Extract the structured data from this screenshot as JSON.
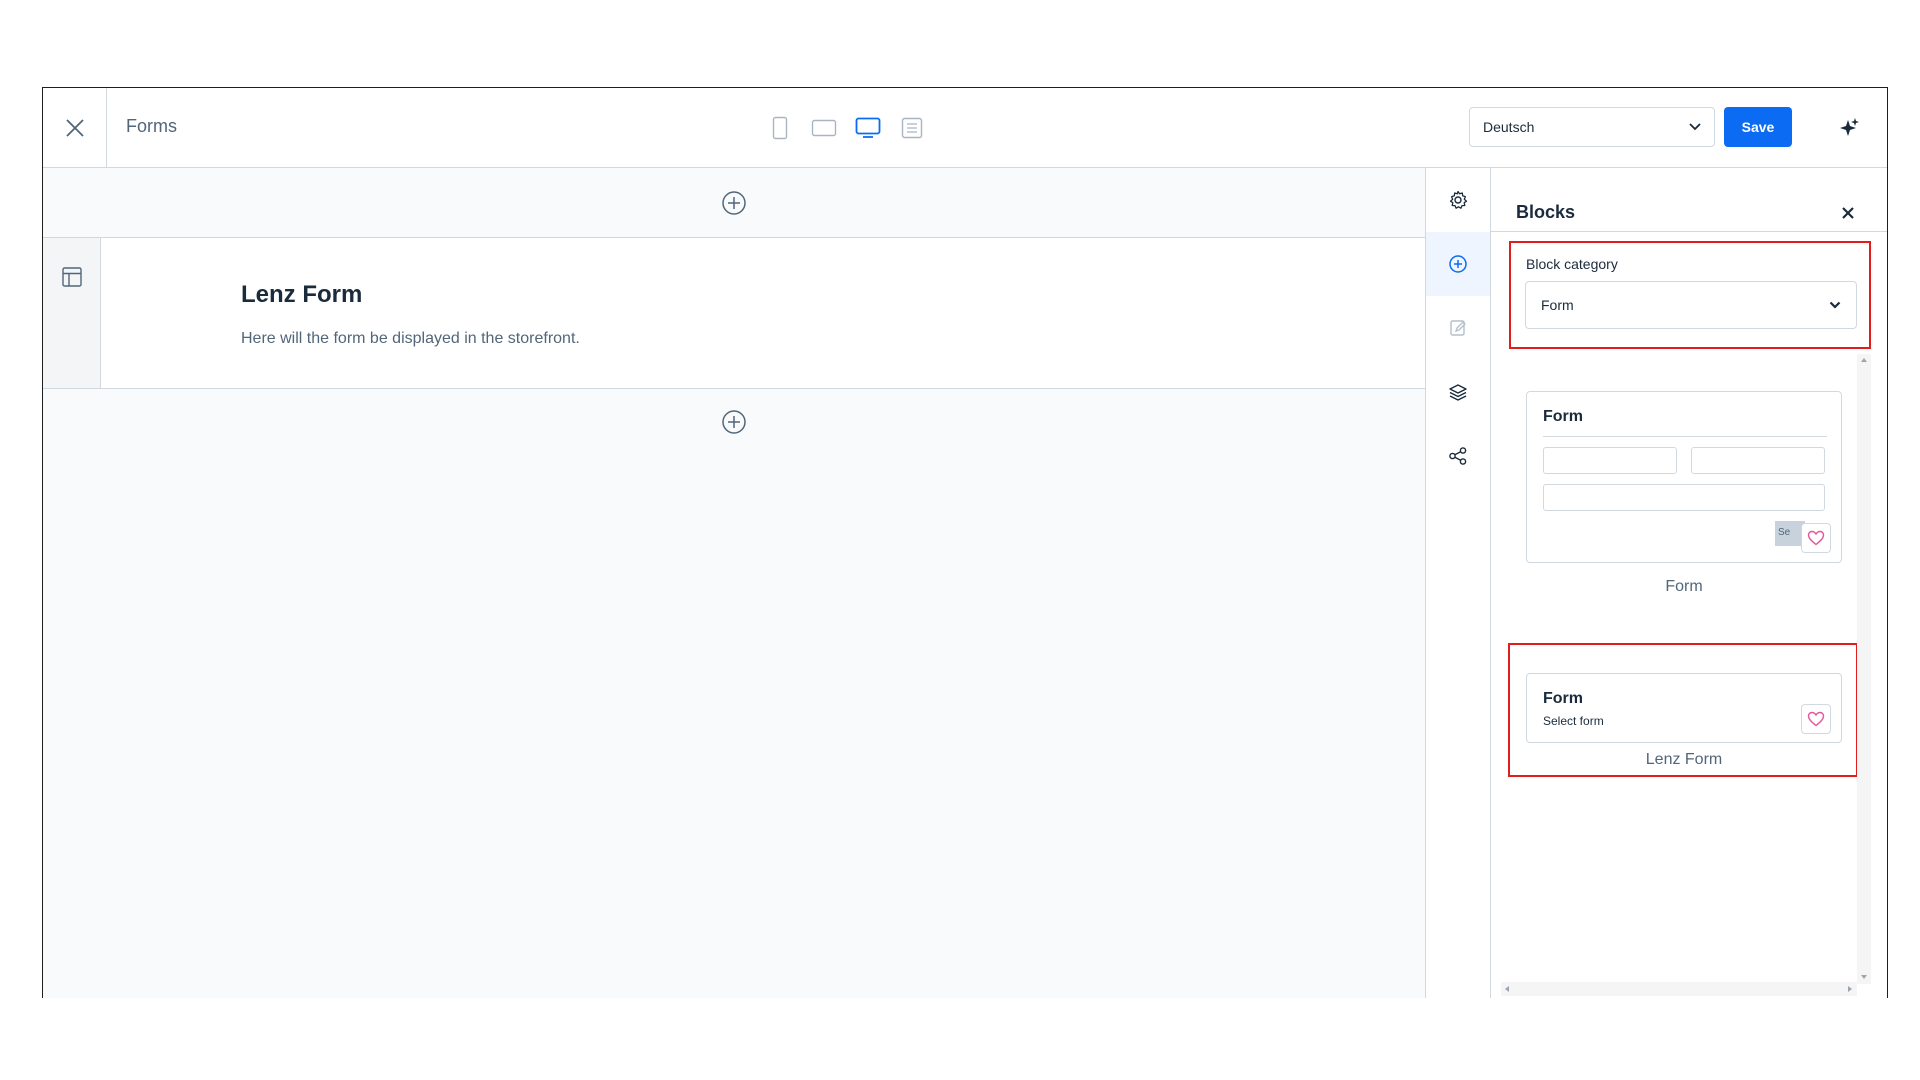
{
  "topbar": {
    "title": "Forms",
    "language": "Deutsch",
    "save_label": "Save",
    "devices": [
      "mobile-icon",
      "tablet-landscape-icon",
      "desktop-icon",
      "list-view-icon"
    ],
    "active_device": "desktop-icon"
  },
  "canvas": {
    "block_title": "Lenz Form",
    "block_text": "Here will the form be displayed in the storefront."
  },
  "sidebar_icons": [
    "settings-icon",
    "add-block-icon",
    "edit-icon",
    "layers-icon",
    "share-icon"
  ],
  "panel": {
    "title": "Blocks",
    "category_label": "Block category",
    "category_value": "Form",
    "blocks": [
      {
        "card_title": "Form",
        "button_text": "Se",
        "caption": "Form"
      },
      {
        "card_title": "Form",
        "card_subtitle": "Select form",
        "caption": "Lenz Form"
      }
    ]
  },
  "colors": {
    "accent": "#0b6cf3",
    "highlight": "#e11d1d",
    "border": "#d1d9e0",
    "favorite": "#e5579a"
  }
}
